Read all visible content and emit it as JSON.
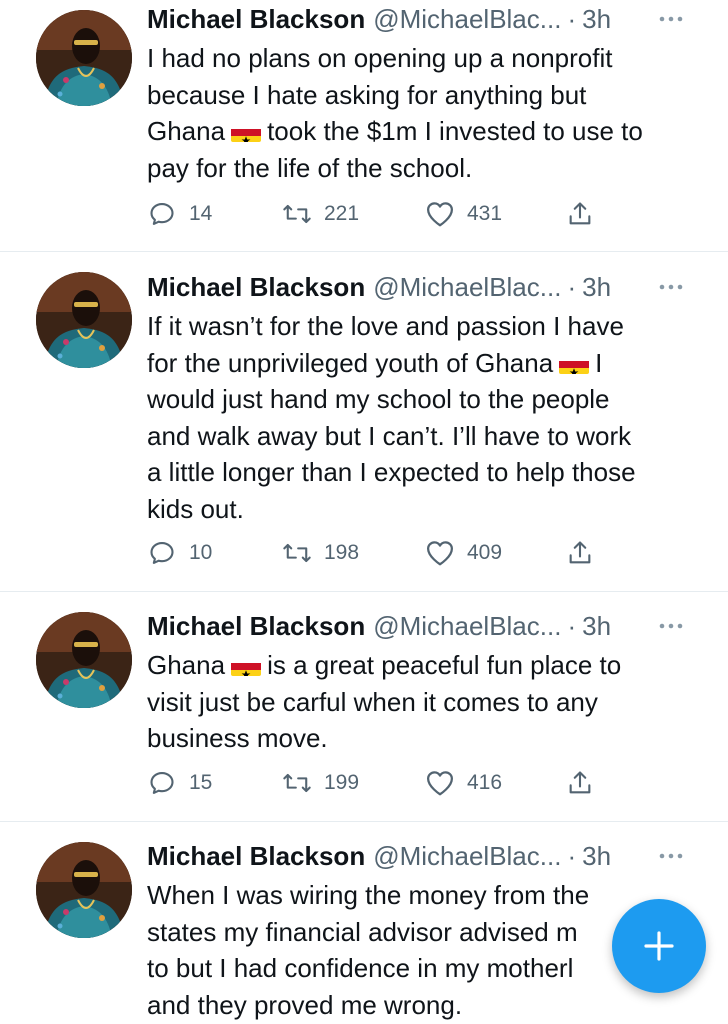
{
  "tweets": [
    {
      "name": "Michael Blackson",
      "handle": "@MichaelBlac...",
      "dot": "·",
      "time": "3h",
      "lines": [
        {
          "a": "I had no plans on opening up a nonprofit"
        },
        {
          "a": "because I hate asking for anything but"
        },
        {
          "a": "Ghana",
          "flag": true,
          "b": "took the $1m I invested to use to"
        },
        {
          "a": "pay for the life of the school."
        }
      ],
      "replies": "14",
      "retweets": "221",
      "likes": "431"
    },
    {
      "name": "Michael Blackson",
      "handle": "@MichaelBlac...",
      "dot": "·",
      "time": "3h",
      "lines": [
        {
          "a": "If it wasn’t for the love and passion I have"
        },
        {
          "a": "for the unprivileged youth of Ghana",
          "flag": true,
          "b": "I"
        },
        {
          "a": "would just hand my school to the people"
        },
        {
          "a": "and walk away but I can’t. I’ll have to work"
        },
        {
          "a": "a little longer than I expected to help those"
        },
        {
          "a": "kids out."
        }
      ],
      "replies": "10",
      "retweets": "198",
      "likes": "409"
    },
    {
      "name": "Michael Blackson",
      "handle": "@MichaelBlac...",
      "dot": "·",
      "time": "3h",
      "lines": [
        {
          "a": "Ghana",
          "flag": true,
          "b": "is a great peaceful fun place to"
        },
        {
          "a": "visit just be carful when it comes to any"
        },
        {
          "a": "business move."
        }
      ],
      "replies": "15",
      "retweets": "199",
      "likes": "416"
    },
    {
      "name": "Michael Blackson",
      "handle": "@MichaelBlac...",
      "dot": "·",
      "time": "3h",
      "lines": [
        {
          "a": "When I was wiring the money from the"
        },
        {
          "a": "states my financial advisor advised m"
        },
        {
          "a": "to but I had confidence in my motherl"
        },
        {
          "a": "and they proved me wrong."
        }
      ]
    }
  ],
  "icons": {
    "reply": "reply-icon",
    "retweet": "retweet-icon",
    "like": "heart-icon",
    "share": "share-icon",
    "more": "more-icon",
    "compose": "plus-icon"
  },
  "colors": {
    "text": "#0f1419",
    "secondary": "#536471",
    "divider": "#e6ecf0",
    "accent": "#1d9bf0"
  }
}
